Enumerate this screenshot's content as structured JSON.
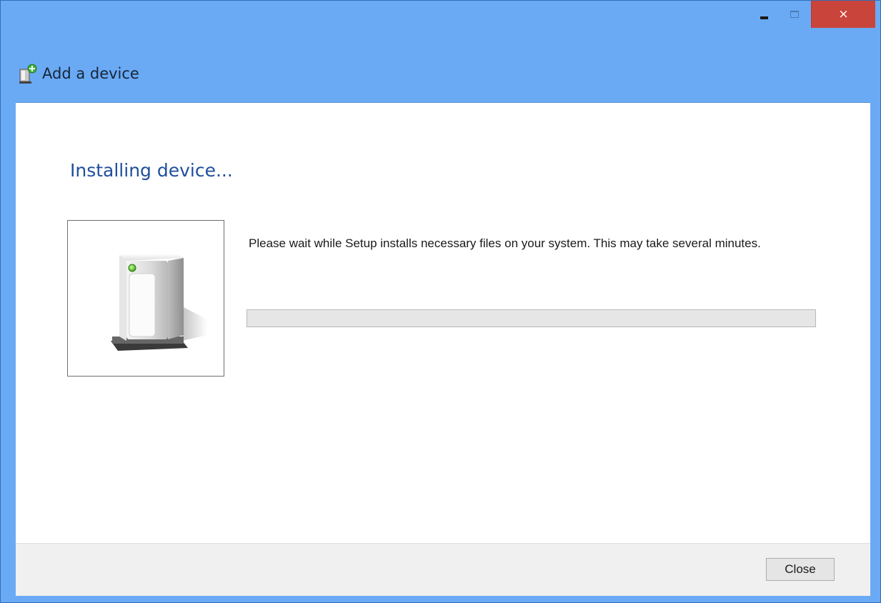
{
  "window": {
    "title": "Add a device",
    "close_glyph": "×"
  },
  "main": {
    "heading": "Installing device...",
    "message": "Please wait while Setup installs necessary files on your system. This may take several minutes.",
    "progress": 0,
    "device_icon": "external-drive-icon"
  },
  "footer": {
    "close_label": "Close"
  },
  "colors": {
    "titlebar": "#6aaaf5",
    "close_button": "#c9443a",
    "heading": "#1f4f9c",
    "progress_track": "#e6e6e6",
    "progress_fill": "#06b025"
  }
}
